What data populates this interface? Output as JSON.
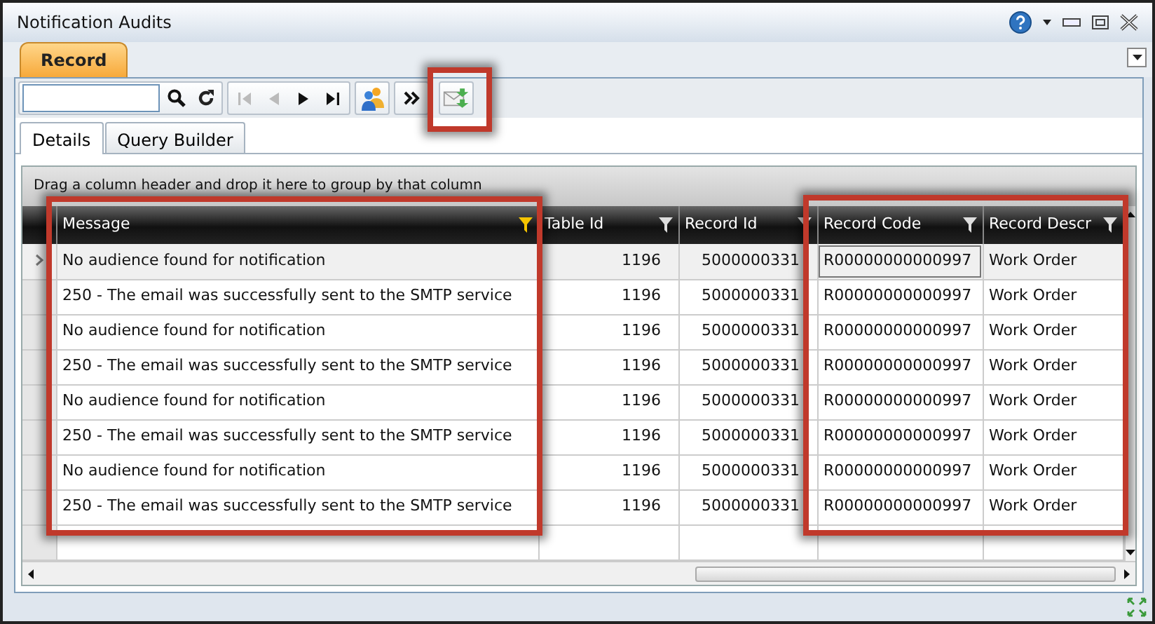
{
  "window": {
    "title": "Notification Audits"
  },
  "ribbon_tabs": [
    {
      "label": "Record",
      "selected": true
    }
  ],
  "tabs": [
    {
      "label": "Details",
      "selected": true
    },
    {
      "label": "Query Builder",
      "selected": false
    }
  ],
  "group_panel": {
    "hint": "Drag a column header and drop it here to group by that column"
  },
  "table": {
    "columns": [
      {
        "label": "Message",
        "filtered": true,
        "kind": "text"
      },
      {
        "label": "Table Id",
        "filtered": false,
        "kind": "number"
      },
      {
        "label": "Record Id",
        "filtered": false,
        "kind": "number"
      },
      {
        "label": "Record Code",
        "filtered": false,
        "kind": "text"
      },
      {
        "label": "Record Descr",
        "filtered": false,
        "kind": "text"
      }
    ],
    "rows": [
      {
        "selected": true,
        "cells": [
          "No audience found for notification",
          "1196",
          "5000000331",
          "R00000000000997",
          "Work Order"
        ]
      },
      {
        "selected": false,
        "cells": [
          "250 - The email was successfully sent to the SMTP service",
          "1196",
          "5000000331",
          "R00000000000997",
          "Work Order"
        ]
      },
      {
        "selected": false,
        "cells": [
          "No audience found for notification",
          "1196",
          "5000000331",
          "R00000000000997",
          "Work Order"
        ]
      },
      {
        "selected": false,
        "cells": [
          "250 - The email was successfully sent to the SMTP service",
          "1196",
          "5000000331",
          "R00000000000997",
          "Work Order"
        ]
      },
      {
        "selected": false,
        "cells": [
          "No audience found for notification",
          "1196",
          "5000000331",
          "R00000000000997",
          "Work Order"
        ]
      },
      {
        "selected": false,
        "cells": [
          "250 - The email was successfully sent to the SMTP service",
          "1196",
          "5000000331",
          "R00000000000997",
          "Work Order"
        ]
      },
      {
        "selected": false,
        "cells": [
          "No audience found for notification",
          "1196",
          "5000000331",
          "R00000000000997",
          "Work Order"
        ]
      },
      {
        "selected": false,
        "cells": [
          "250 - The email was successfully sent to the SMTP service",
          "1196",
          "5000000331",
          "R00000000000997",
          "Work Order"
        ]
      }
    ]
  }
}
